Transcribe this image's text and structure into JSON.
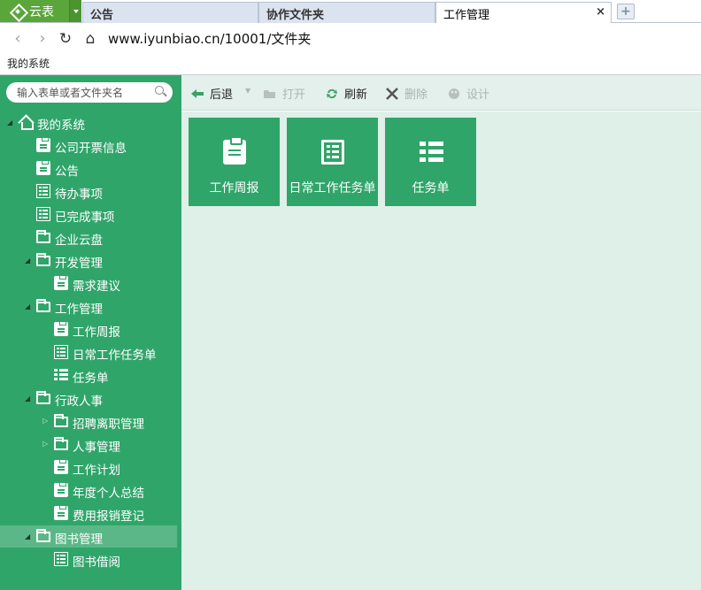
{
  "browser": {
    "app_button": "云表",
    "tabs": [
      {
        "label": "公告"
      },
      {
        "label": "协作文件夹"
      },
      {
        "label": "工作管理",
        "close": "×"
      }
    ],
    "new_tab": "+",
    "url": "www.iyunbiao.cn/10001/文件夹",
    "bookmark": "我的系统"
  },
  "sidebar": {
    "search_placeholder": "输入表单或者文件夹名",
    "root": "我的系统",
    "items": [
      {
        "label": "公司开票信息",
        "icon": "clipboard-list-icon"
      },
      {
        "label": "公告",
        "icon": "clipboard-icon"
      },
      {
        "label": "待办事项",
        "icon": "list-icon"
      },
      {
        "label": "已完成事项",
        "icon": "list-icon"
      },
      {
        "label": "企业云盘",
        "icon": "folder-icon"
      },
      {
        "label": "开发管理",
        "icon": "folder-icon"
      },
      {
        "label": "需求建议",
        "icon": "clipboard-icon"
      },
      {
        "label": "工作管理",
        "icon": "folder-icon"
      },
      {
        "label": "工作周报",
        "icon": "clipboard-icon"
      },
      {
        "label": "日常工作任务单",
        "icon": "list-icon"
      },
      {
        "label": "任务单",
        "icon": "tree-icon"
      },
      {
        "label": "行政人事",
        "icon": "folder-icon"
      },
      {
        "label": "招聘离职管理",
        "icon": "folder-icon"
      },
      {
        "label": "人事管理",
        "icon": "folder-icon"
      },
      {
        "label": "工作计划",
        "icon": "clipboard-icon"
      },
      {
        "label": "年度个人总结",
        "icon": "clipboard-icon"
      },
      {
        "label": "费用报销登记",
        "icon": "clipboard-list-icon"
      },
      {
        "label": "图书管理",
        "icon": "folder-icon"
      },
      {
        "label": "图书借阅",
        "icon": "list-icon"
      }
    ]
  },
  "toolbar": {
    "back": "后退",
    "open": "打开",
    "refresh": "刷新",
    "delete": "删除",
    "design": "设计"
  },
  "cards": [
    {
      "label": "工作周报",
      "icon": "clipboard-icon"
    },
    {
      "label": "日常工作任务单",
      "icon": "list-icon"
    },
    {
      "label": "任务单",
      "icon": "tree-icon"
    }
  ],
  "colors": {
    "accent": "#30a56a",
    "selected": "#5cb788",
    "app_button": "#5aa63a",
    "content_bg": "#dff0e9"
  }
}
